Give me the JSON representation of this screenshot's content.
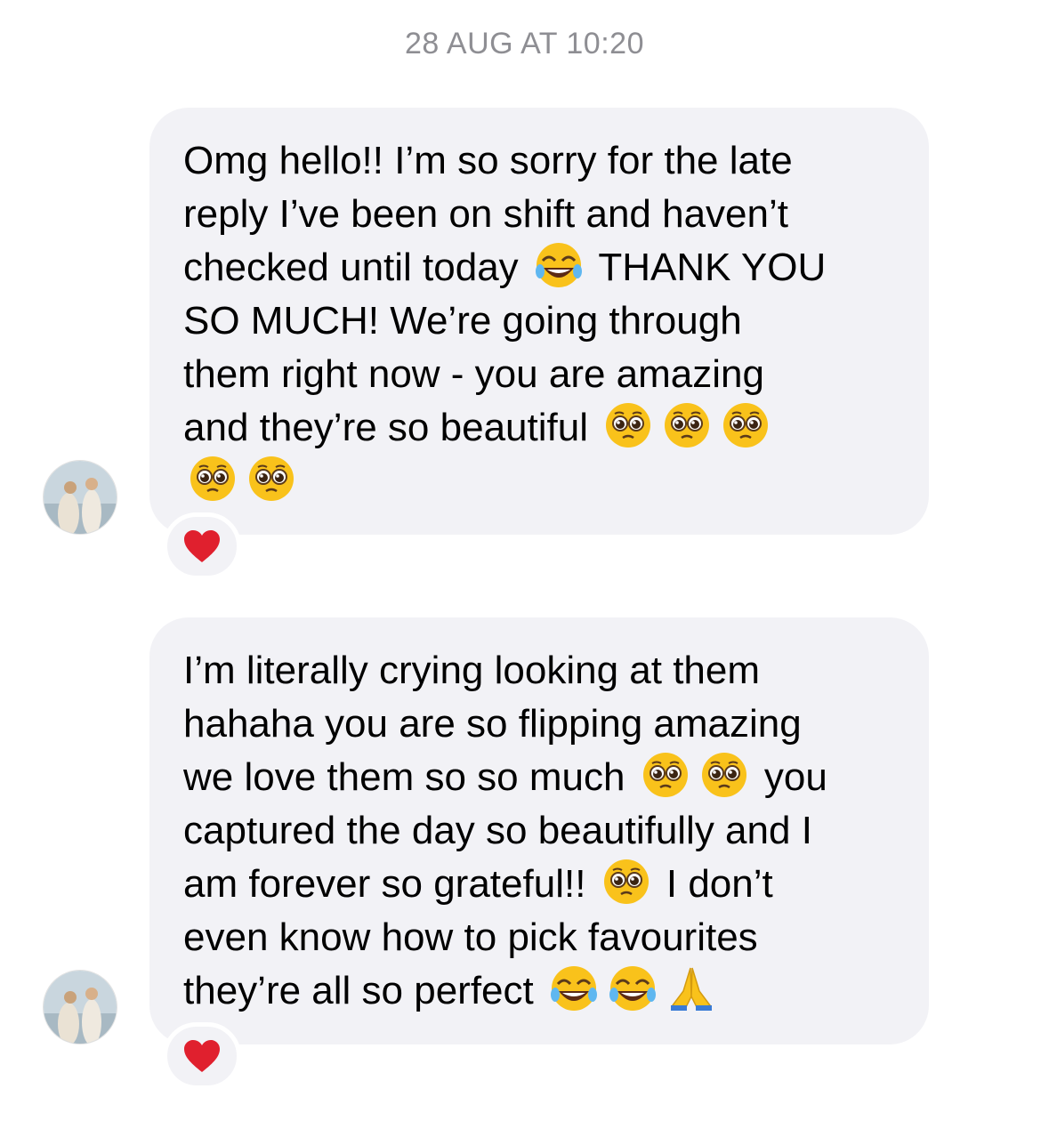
{
  "timestamp": "28 AUG AT 10:20",
  "messages": [
    {
      "lines": [
        [
          "Omg hello!! I’m so sorry for the late"
        ],
        [
          "reply I’ve been on shift and haven’t"
        ],
        [
          "checked until today ",
          "{laugh}",
          " THANK YOU"
        ],
        [
          "SO MUCH! We’re going through"
        ],
        [
          "them right now - you are amazing"
        ],
        [
          "and they’re so beautiful ",
          "{plead}",
          "{plead}",
          "{plead}"
        ],
        [
          "{plead}",
          "{plead}"
        ]
      ],
      "reaction": "red-heart"
    },
    {
      "lines": [
        [
          "I’m literally crying looking at them"
        ],
        [
          "hahaha you are so flipping amazing"
        ],
        [
          "we love them so so much ",
          "{plead}",
          "{plead}",
          " you"
        ],
        [
          "captured the day so beautifully and I"
        ],
        [
          "am forever so grateful!! ",
          "{plead}",
          " I don’t"
        ],
        [
          "even know how to pick favourites"
        ],
        [
          "they’re all so perfect ",
          "{laugh}",
          "{laugh}",
          "{pray}"
        ]
      ],
      "reaction": "red-heart"
    }
  ],
  "icons": {
    "laugh": "face-with-tears-of-joy-icon",
    "plead": "pleading-face-icon",
    "pray": "folded-hands-icon",
    "heart": "red-heart-icon"
  },
  "colors": {
    "bubble": "#f2f2f6",
    "timestamp": "#8e8e93",
    "heart": "#e0202e",
    "emoji_yellow": "#f9c21b"
  }
}
